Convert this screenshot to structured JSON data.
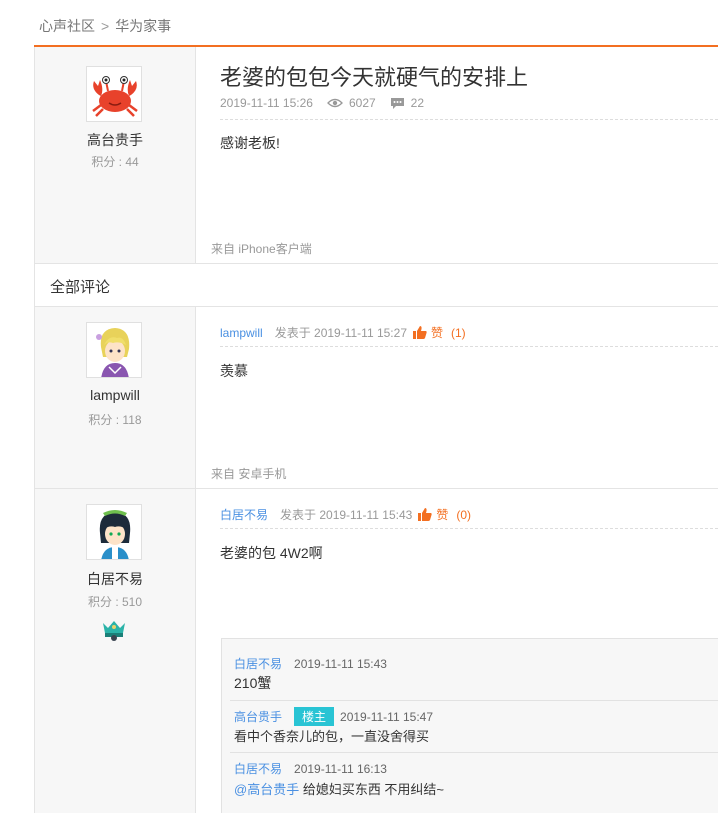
{
  "breadcrumb": {
    "root": "心声社区",
    "separator": ">",
    "current": "华为家事"
  },
  "post": {
    "title": "老婆的包包今天就硬气的安排上",
    "date": "2019-11-11 15:26",
    "views": "6027",
    "comments": "22",
    "body": "感谢老板!",
    "source": "来自 iPhone客户端",
    "author": {
      "name": "高台贵手",
      "score": "积分 : 44"
    }
  },
  "section_title": "全部评论",
  "comments": [
    {
      "user": "lampwill",
      "posted": "发表于 2019-11-11 15:27",
      "like_label": "赞",
      "like_count": "(1)",
      "body": "羡慕",
      "source": "来自 安卓手机",
      "author": {
        "name": "lampwill",
        "score": "积分 : 118"
      }
    },
    {
      "user": "白居不易",
      "posted": "发表于 2019-11-11 15:43",
      "like_label": "赞",
      "like_count": "(0)",
      "body": "老婆的包 4W2啊",
      "author": {
        "name": "白居不易",
        "score": "积分 : 510"
      },
      "replies": [
        {
          "user": "白居不易",
          "time": "2019-11-11 15:43",
          "text": "210蟹"
        },
        {
          "user": "高台贵手",
          "badge": "楼主",
          "time": "2019-11-11 15:47",
          "text": "看中个香奈儿的包，一直没舍得买"
        },
        {
          "user": "白居不易",
          "time": "2019-11-11 16:13",
          "mention": "@高台贵手",
          "text": " 给媳妇买东西 不用纠结~"
        }
      ]
    }
  ],
  "colors": {
    "accent": "#f36f21",
    "link": "#4a90e2",
    "badge": "#29c4d4"
  }
}
